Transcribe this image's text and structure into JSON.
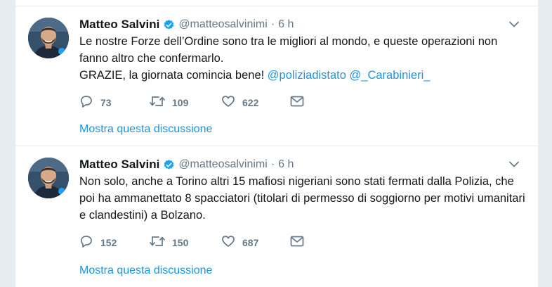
{
  "tweets": [
    {
      "author_name": "Matteo Salvini",
      "handle": "@matteosalvinimi",
      "separator": "·",
      "time": "6 h",
      "text_line1": "Le nostre Forze dell’Ordine sono tra le migliori al mondo, e queste operazioni non fanno altro che confermarlo.",
      "text_line2_plain": "GRAZIE, la giornata comincia bene! ",
      "mention1": "@poliziadistato",
      "mention2": "@_Carabinieri_",
      "replies": "73",
      "retweets": "109",
      "likes": "622",
      "thread_link": "Mostra questa discussione"
    },
    {
      "author_name": "Matteo Salvini",
      "handle": "@matteosalvinimi",
      "separator": "·",
      "time": "6 h",
      "text": "Non solo, anche a Torino altri 15 mafiosi nigeriani sono stati fermati dalla Polizia, che poi ha ammanettato 8 spacciatori (titolari di permesso di soggiorno per motivi umanitari e clandestini) a Bolzano.",
      "replies": "152",
      "retweets": "150",
      "likes": "687",
      "thread_link": "Mostra questa discussione"
    }
  ],
  "icons": {
    "verified": "verified-badge-icon",
    "caret": "chevron-down-icon",
    "reply": "reply-icon",
    "retweet": "retweet-icon",
    "like": "heart-icon",
    "dm": "envelope-icon"
  },
  "colors": {
    "background": "#e6ecf0",
    "text": "#14171a",
    "secondary": "#657786",
    "link": "#1b95e0",
    "verified": "#1da1f2"
  }
}
